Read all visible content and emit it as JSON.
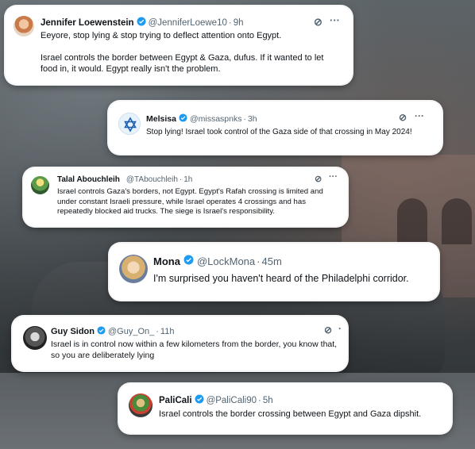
{
  "colors": {
    "verified": "#1d9bf0",
    "text": "#0f1419",
    "muted": "#536471"
  },
  "tweets": [
    {
      "name": "Jennifer Loewenstein",
      "handle": "@JenniferLoewe10",
      "dot": "·",
      "time": "9h",
      "text": "Eeyore, stop lying & stop trying to deflect attention onto Egypt.\n\nIsrael controls the border between Egypt & Gaza, dufus. If it wanted to let food in, it would. Egypt really isn't the problem.",
      "icons": [
        "grok-icon",
        "more-icon"
      ]
    },
    {
      "name": "Melsisa",
      "handle": "@missaspnks",
      "dot": "·",
      "time": "3h",
      "text": "Stop lying! Israel took control of the Gaza side of that crossing in May 2024!",
      "icons": [
        "grok-icon",
        "more-icon"
      ]
    },
    {
      "name": "Talal Abouchleih",
      "handle": "@TAbouchleih",
      "dot": "·",
      "time": "1h",
      "text": "Israel controls Gaza's borders, not Egypt. Egypt's Rafah crossing is limited and under constant Israeli pressure, while Israel operates 4 crossings and has repeatedly blocked aid trucks. The siege is Israel's responsibility.",
      "icons": [
        "grok-icon",
        "more-icon"
      ]
    },
    {
      "name": "Mona",
      "handle": "@LockMona",
      "dot": "·",
      "time": "45m",
      "text": "I'm surprised you haven't heard of the Philadelphi corridor.",
      "icons": []
    },
    {
      "name": "Guy Sidon",
      "handle": "@Guy_On_",
      "dot": "·",
      "time": "11h",
      "text": "Israel is in control now within a few kilometers from the border, you know that, so you are deliberately lying",
      "icons": [
        "grok-icon",
        "more-icon"
      ]
    },
    {
      "name": "PaliCali",
      "handle": "@PaliCali90",
      "dot": "·",
      "time": "5h",
      "text": "Israel controls the border crossing between Egypt and Gaza dipshit.",
      "icons": []
    }
  ]
}
